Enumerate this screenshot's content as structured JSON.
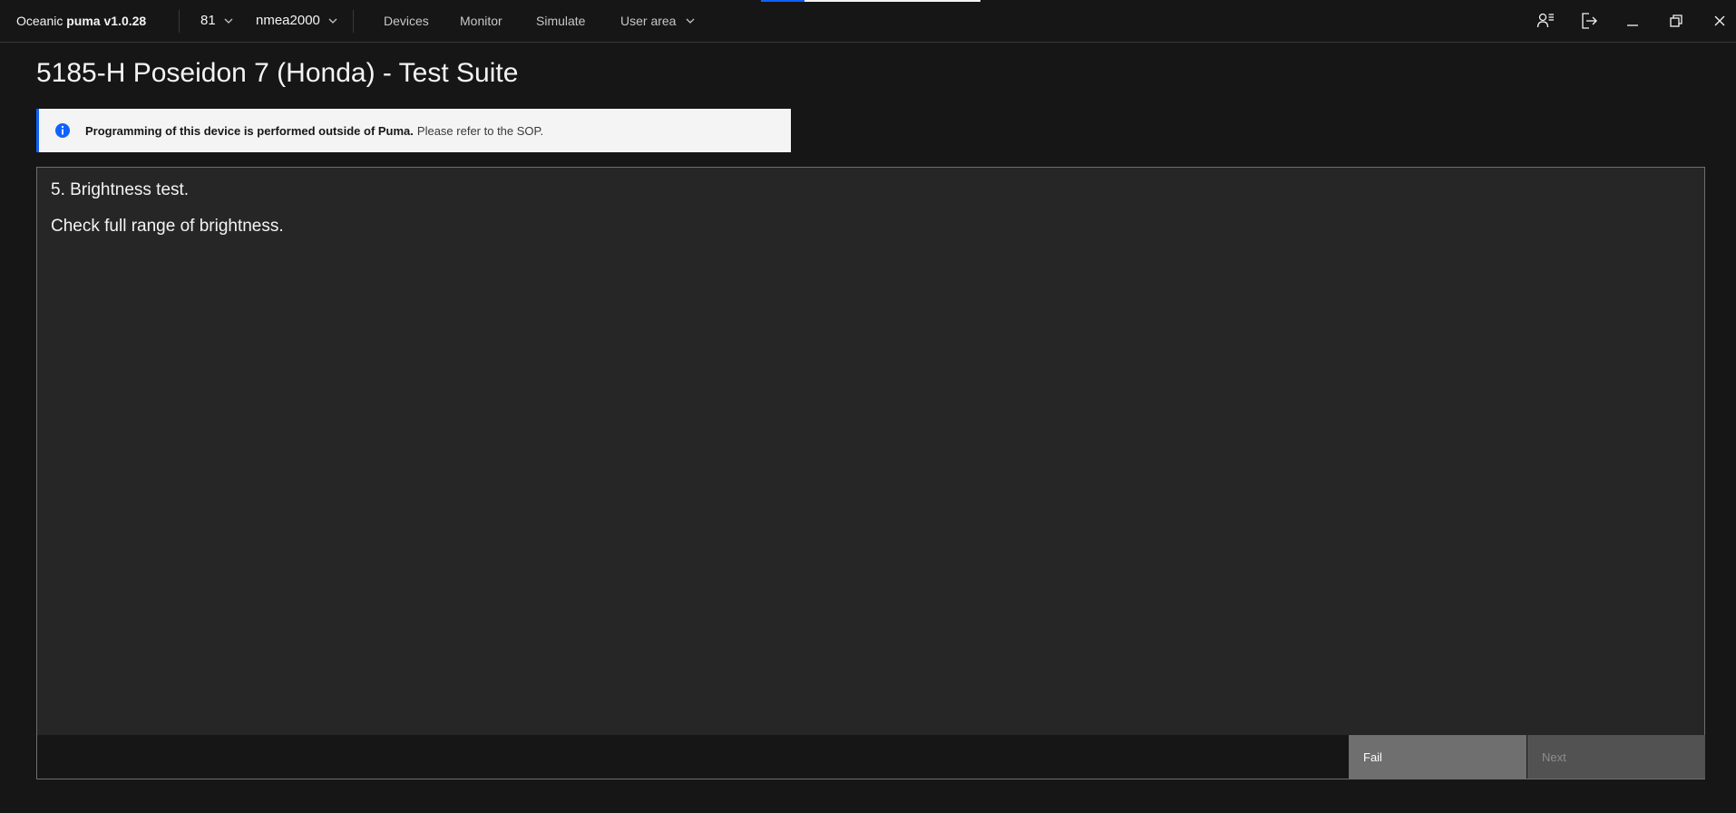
{
  "app": {
    "brand_prefix": "Oceanic",
    "brand_name": "puma",
    "version": "v1.0.28"
  },
  "progress": {
    "fraction": 0.2
  },
  "topbar": {
    "device_select": "81",
    "protocol_select": "nmea2000",
    "nav": [
      {
        "label": "Devices"
      },
      {
        "label": "Monitor"
      },
      {
        "label": "Simulate"
      },
      {
        "label": "User area"
      }
    ],
    "icons": [
      "user-list-icon",
      "logout-icon",
      "minimize-icon",
      "restore-icon",
      "close-icon"
    ]
  },
  "page": {
    "title": "5185-H Poseidon 7 (Honda) - Test Suite"
  },
  "notice": {
    "strong": "Programming of this device is performed outside of Puma.",
    "rest": "Please refer to the SOP."
  },
  "test": {
    "step_title": "5. Brightness test.",
    "step_description": "Check full range of brightness.",
    "fail_label": "Fail",
    "next_label": "Next"
  },
  "colors": {
    "background": "#161616",
    "panel": "#262626",
    "accent": "#0f62fe",
    "notice_bg": "#f4f4f4",
    "fail_bg": "#6f6f6f",
    "next_bg": "#525252"
  }
}
